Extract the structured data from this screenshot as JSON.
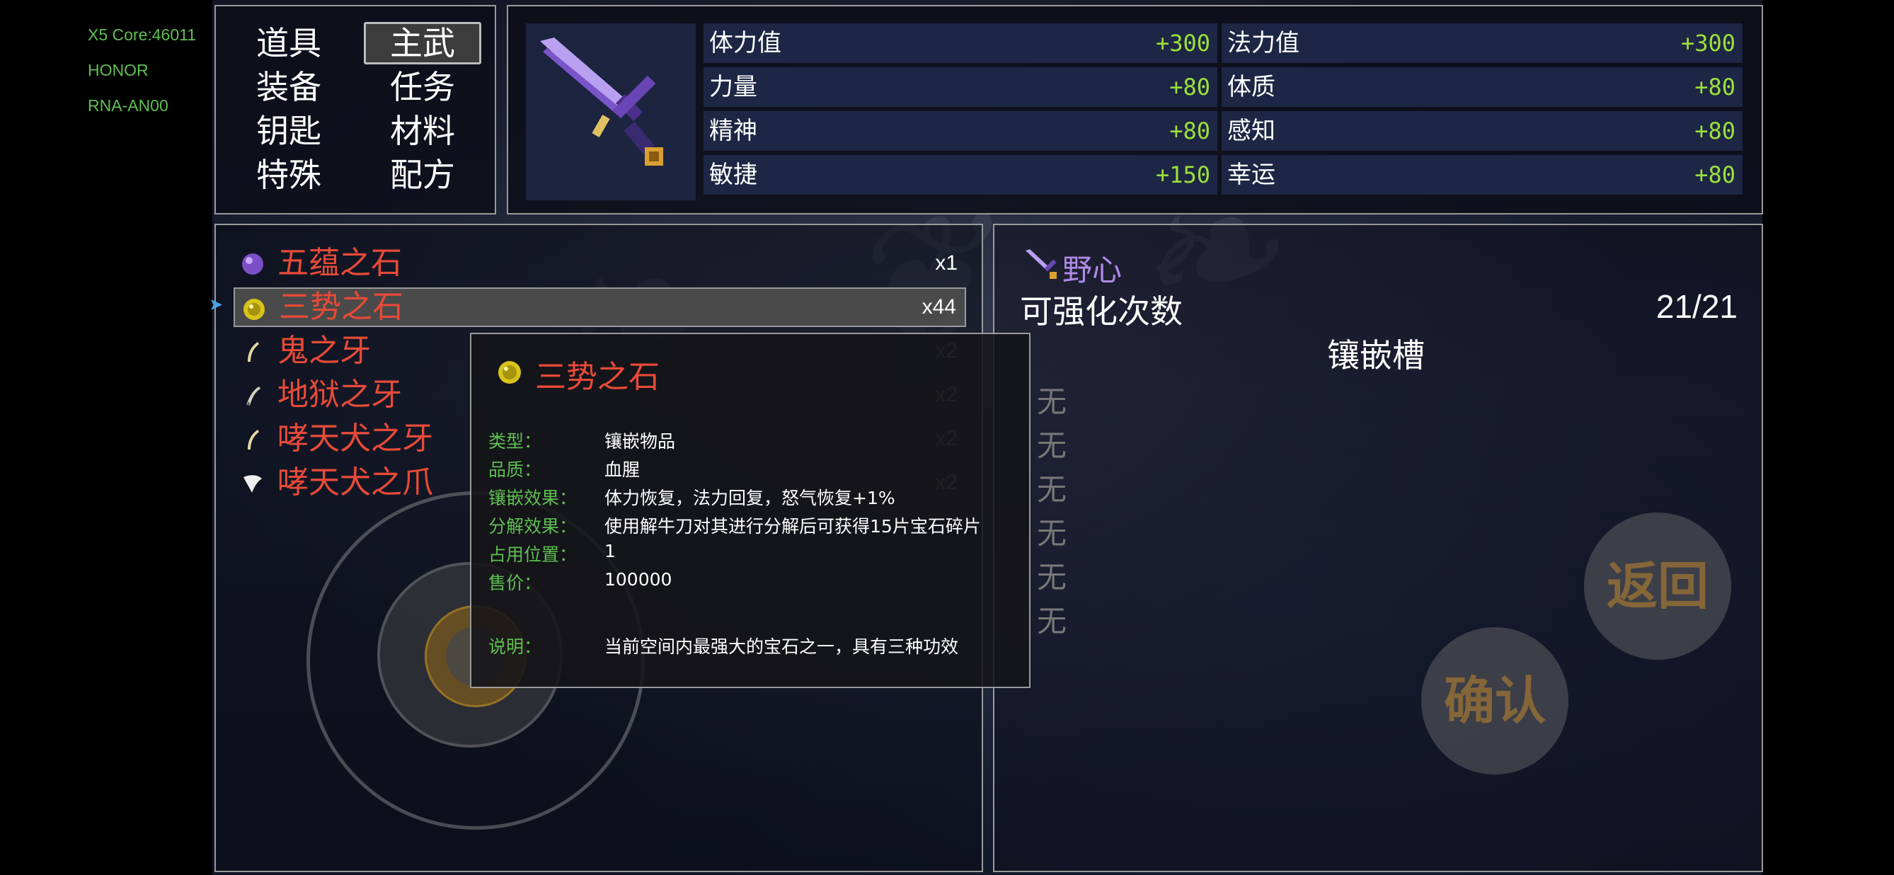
{
  "device": {
    "core": "X5 Core:46011",
    "brand": "HONOR",
    "model": "RNA-AN00"
  },
  "categories": [
    {
      "label": "道具",
      "active": false
    },
    {
      "label": "主武",
      "active": true
    },
    {
      "label": "装备",
      "active": false
    },
    {
      "label": "任务",
      "active": false
    },
    {
      "label": "钥匙",
      "active": false
    },
    {
      "label": "材料",
      "active": false
    },
    {
      "label": "特殊",
      "active": false
    },
    {
      "label": "配方",
      "active": false
    }
  ],
  "stats": [
    {
      "name": "体力值",
      "value": "+300"
    },
    {
      "name": "法力值",
      "value": "+300"
    },
    {
      "name": "力量",
      "value": "+80"
    },
    {
      "name": "体质",
      "value": "+80"
    },
    {
      "name": "精神",
      "value": "+80"
    },
    {
      "name": "感知",
      "value": "+80"
    },
    {
      "name": "敏捷",
      "value": "+150"
    },
    {
      "name": "幸运",
      "value": "+80"
    }
  ],
  "items": [
    {
      "name": "五蕴之石",
      "qty": "x1",
      "icon": "purple-orb-icon"
    },
    {
      "name": "三势之石",
      "qty": "x44",
      "icon": "yellow-gem-icon"
    },
    {
      "name": "鬼之牙",
      "qty": "x2",
      "icon": "fang-icon"
    },
    {
      "name": "地狱之牙",
      "qty": "x2",
      "icon": "dark-fang-icon"
    },
    {
      "name": "哮天犬之牙",
      "qty": "x2",
      "icon": "fang-icon"
    },
    {
      "name": "哮天犬之爪",
      "qty": "x2",
      "icon": "claw-icon"
    }
  ],
  "tooltip": {
    "title": "三势之石",
    "rows": [
      {
        "label": "类型：",
        "value": "镶嵌物品"
      },
      {
        "label": "品质：",
        "value": "血腥"
      },
      {
        "label": "镶嵌效果：",
        "value": "体力恢复，法力回复，怒气恢复+1%"
      },
      {
        "label": "分解效果：",
        "value": "使用解牛刀对其进行分解后可获得15片宝石碎片"
      },
      {
        "label": "占用位置：",
        "value": "1"
      },
      {
        "label": "售价：",
        "value": "100000"
      },
      {
        "label": "说明：",
        "value": "当前空间内最强大的宝石之一，具有三种功效"
      }
    ]
  },
  "equipment": {
    "name": "野心",
    "enhance_label": "可强化次数",
    "enhance_value": "21/21",
    "socket_label": "镶嵌槽",
    "sockets": [
      "无",
      "无",
      "无",
      "无",
      "无",
      "无"
    ]
  },
  "buttons": {
    "back": "返回",
    "confirm": "确认"
  },
  "colors": {
    "item_red": "#e74a38",
    "stat_green": "#9de03a",
    "label_green": "#5fbf52",
    "equip_purple": "#b08be8"
  }
}
